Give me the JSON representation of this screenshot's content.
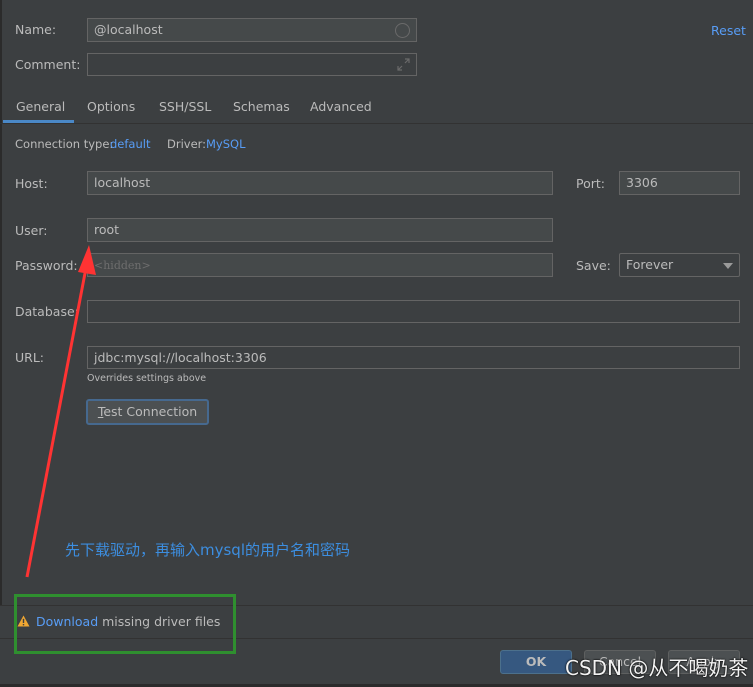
{
  "header": {
    "name_label": "Name:",
    "name_value": "@localhost",
    "comment_label": "Comment:",
    "comment_value": "",
    "reset_link": "Reset"
  },
  "tabs": [
    {
      "label": "General",
      "active": true
    },
    {
      "label": "Options",
      "active": false
    },
    {
      "label": "SSH/SSL",
      "active": false
    },
    {
      "label": "Schemas",
      "active": false
    },
    {
      "label": "Advanced",
      "active": false
    }
  ],
  "connection": {
    "type_label": "Connection type:",
    "type_value": "default",
    "driver_label": "Driver:",
    "driver_value": "MySQL"
  },
  "form": {
    "host_label": "Host:",
    "host_value": "localhost",
    "port_label": "Port:",
    "port_value": "3306",
    "user_label": "User:",
    "user_value": "root",
    "password_label": "Password:",
    "password_placeholder": "<hidden>",
    "save_label": "Save:",
    "save_value": "Forever",
    "database_label": "Database:",
    "database_value": "",
    "url_label": "URL:",
    "url_value": "jdbc:mysql://localhost:3306",
    "url_hint": "Overrides settings above",
    "test_connection_prefix": "T",
    "test_connection_rest": "est Connection"
  },
  "annotation": {
    "text": "先下载驱动，再输入mysql的用户名和密码",
    "arrow_color": "#ff3333",
    "box_color": "#2f8f2f"
  },
  "footer": {
    "warning_link": "Download",
    "warning_text": " missing driver files",
    "ok_label": "OK",
    "cancel_label": "Cancel",
    "apply_label": "Apply"
  },
  "watermark": "CSDN @从不喝奶茶"
}
